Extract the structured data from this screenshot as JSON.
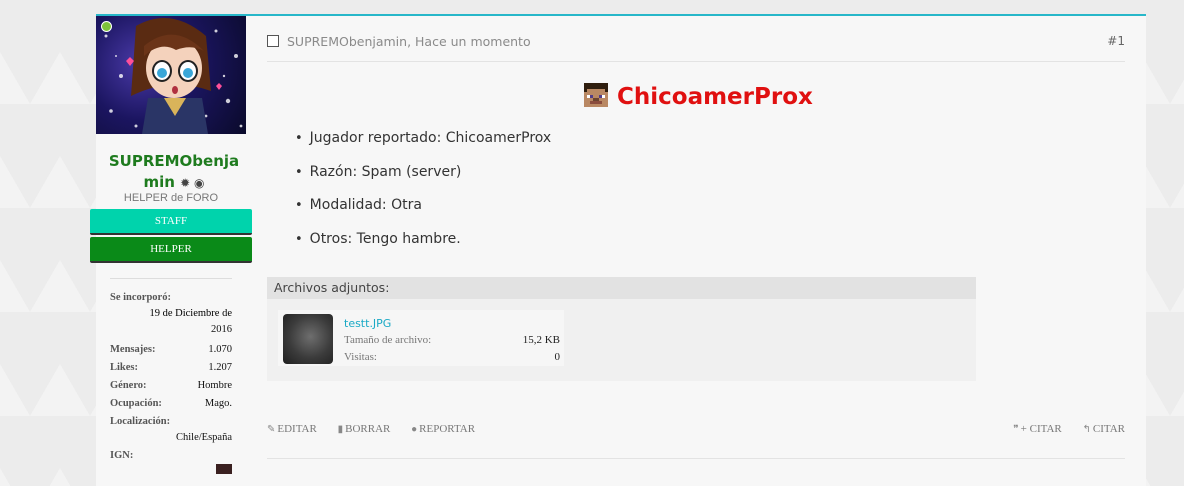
{
  "user": {
    "name_line1": "SUPREMObenja",
    "name_line2": "min",
    "title": "HELPER de FORO",
    "ranks": [
      "STAFF",
      "HELPER"
    ],
    "details": {
      "joined_label": "Se incorporó:",
      "joined_value_1": "19 de Diciembre de",
      "joined_value_2": "2016",
      "messages_label": "Mensajes:",
      "messages_value": "1.070",
      "likes_label": "Likes:",
      "likes_value": "1.207",
      "gender_label": "Género:",
      "gender_value": "Hombre",
      "occupation_label": "Ocupación:",
      "occupation_value": "Mago.",
      "location_label": "Localización:",
      "location_value": "Chile/España",
      "ign_label": "IGN:"
    }
  },
  "post": {
    "meta": "SUPREMObenjamin, Hace un momento",
    "number": "#1",
    "heading": "ChicoamerProx",
    "items": [
      "Jugador reportado: ChicoamerProx",
      "Razón: Spam (server)",
      "Modalidad: Otra",
      "Otros: Tengo hambre."
    ],
    "attachments": {
      "header": "Archivos adjuntos:",
      "file_name": "testt.JPG",
      "size_label": "Tamaño de archivo:",
      "size_value": "15,2 KB",
      "views_label": "Visitas:",
      "views_value": "0"
    },
    "actions": {
      "edit": "EDITAR",
      "delete": "BORRAR",
      "report": "REPORTAR",
      "multiquote": "+ CITAR",
      "quote": "CITAR"
    }
  },
  "colors": {
    "accent": "#27b7c9",
    "username": "#1e7b1e",
    "heading": "#e01010",
    "staff": "#00d3ac",
    "helper": "#0a8a18"
  }
}
